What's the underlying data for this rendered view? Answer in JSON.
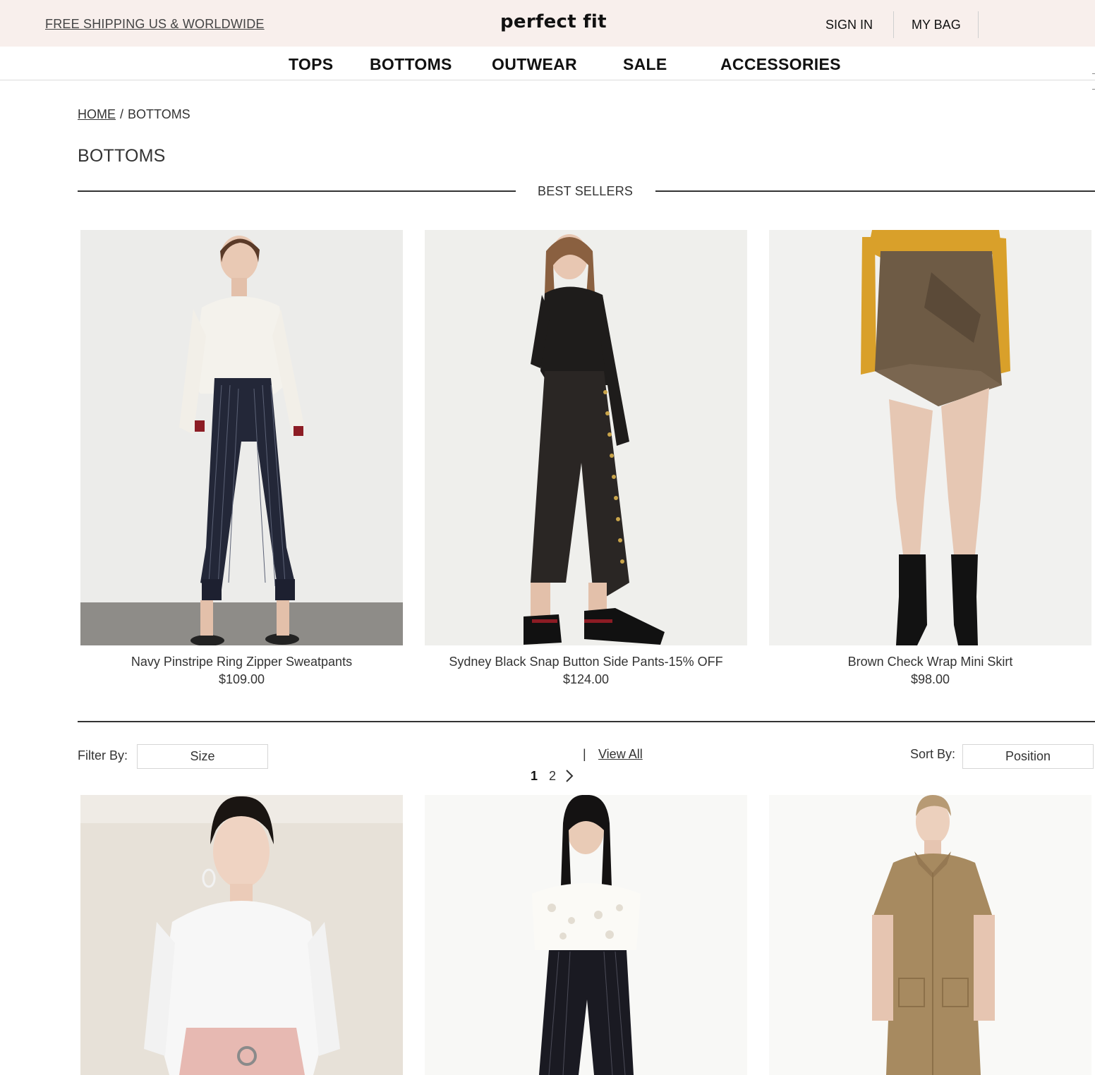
{
  "header": {
    "promo": "FREE SHIPPING US & WORLDWIDE",
    "logo": "perfect fit",
    "sign_in": "SIGN IN",
    "my_bag": "MY BAG"
  },
  "nav": {
    "items": [
      "TOPS",
      "BOTTOMS",
      "OUTWEAR",
      "SALE",
      "ACCESSORIES"
    ]
  },
  "breadcrumb": {
    "home": "HOME",
    "separator": "/",
    "current": "BOTTOMS"
  },
  "page_title": "BOTTOMS",
  "best_sellers": {
    "heading": "BEST SELLERS",
    "products": [
      {
        "name": "Navy Pinstripe Ring Zipper Sweatpants",
        "price": "$109.00"
      },
      {
        "name": "Sydney Black Snap Button Side Pants-15% OFF",
        "price": "$124.00"
      },
      {
        "name": "Brown Check Wrap Mini Skirt",
        "price": "$98.00"
      }
    ]
  },
  "toolbar": {
    "filter_label": "Filter By:",
    "filter_value": "Size",
    "pipe": "|",
    "view_all": "View All",
    "pages": [
      "1",
      "2"
    ],
    "current_page": "1",
    "sort_label": "Sort By:",
    "sort_value": "Position"
  },
  "colors": {
    "topbar_bg": "#f8efec",
    "text": "#333333",
    "heading": "#111111"
  },
  "icons": {
    "next_page": "chevron-right-icon"
  }
}
